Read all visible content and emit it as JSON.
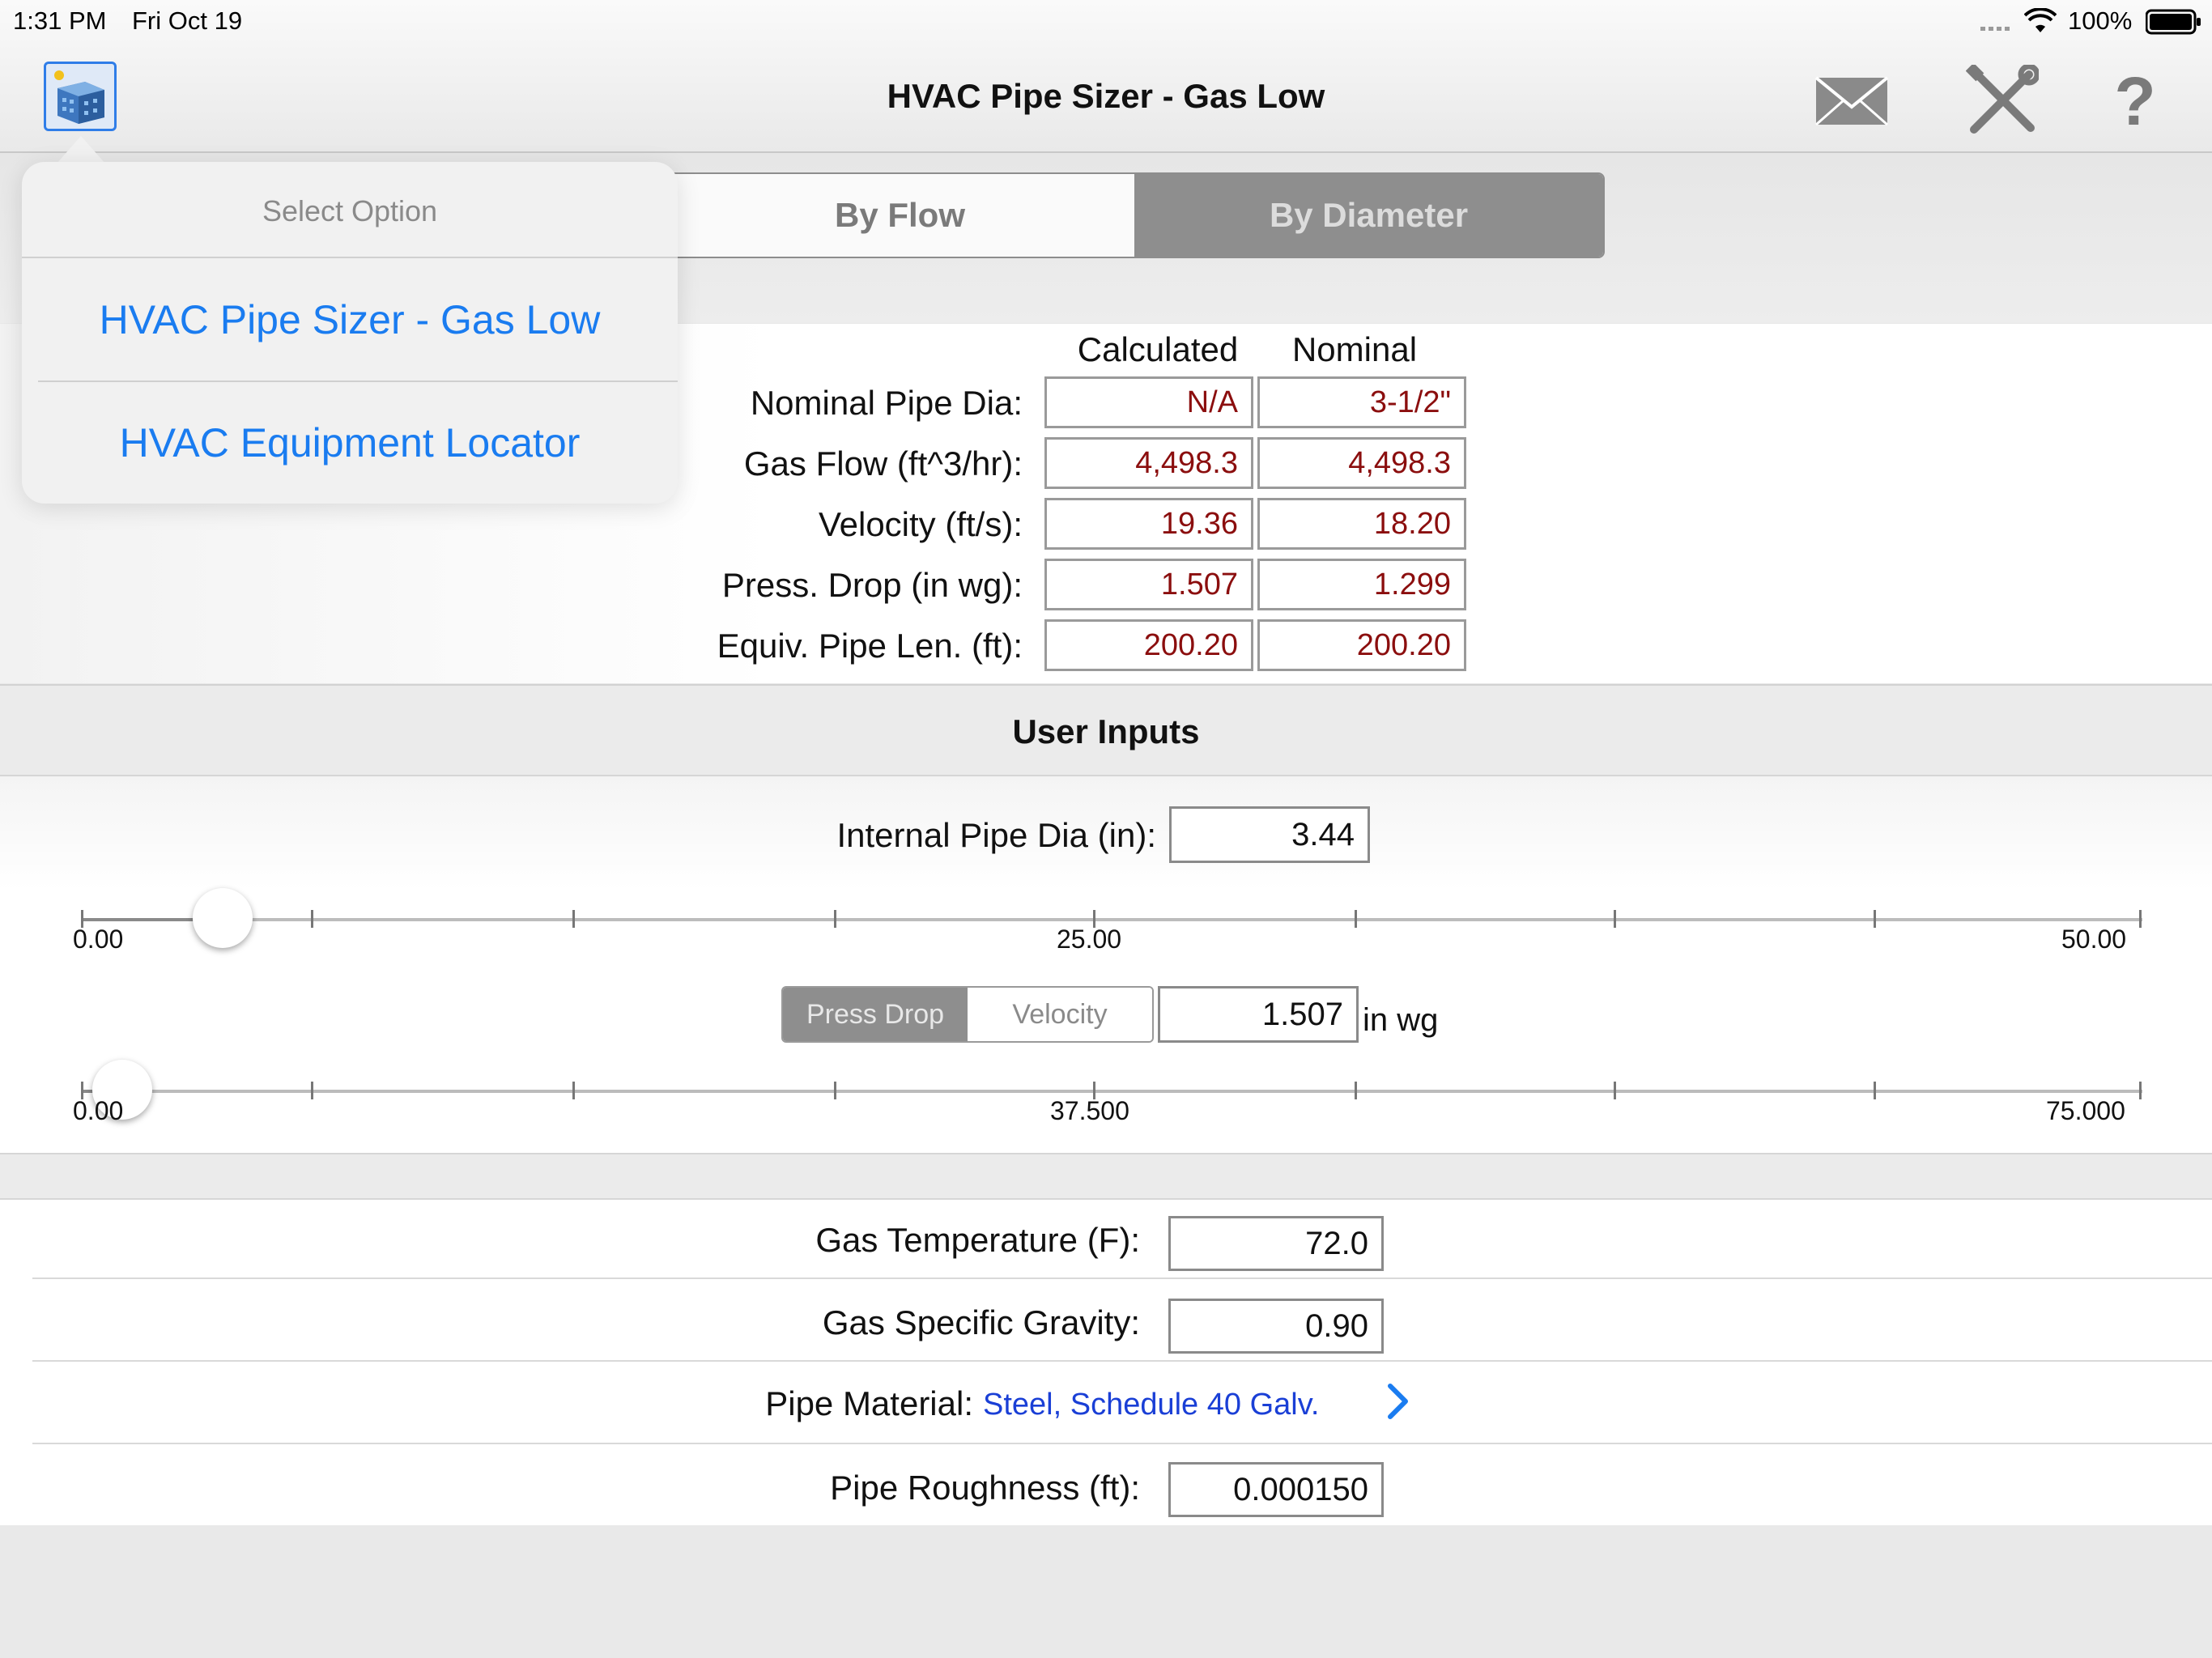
{
  "status_bar": {
    "time": "1:31 PM",
    "date": "Fri Oct 19",
    "battery": "100%"
  },
  "nav": {
    "title": "HVAC Pipe Sizer - Gas Low",
    "icons": [
      "app-icon",
      "mail-icon",
      "tools-icon",
      "help-icon"
    ]
  },
  "segment": {
    "by_flow": "By Flow",
    "by_diameter": "By Diameter",
    "selected": "By Diameter"
  },
  "popover": {
    "title": "Select Option",
    "items": [
      "HVAC Pipe Sizer - Gas Low",
      "HVAC Equipment Locator"
    ]
  },
  "results": {
    "col_calculated": "Calculated",
    "col_nominal": "Nominal",
    "rows": [
      {
        "label": "Nominal Pipe Dia:",
        "calculated": "N/A",
        "nominal": "3-1/2\""
      },
      {
        "label": "Gas Flow (ft^3/hr):",
        "calculated": "4,498.3",
        "nominal": "4,498.3"
      },
      {
        "label": "Velocity (ft/s):",
        "calculated": "19.36",
        "nominal": "18.20"
      },
      {
        "label": "Press. Drop (in wg):",
        "calculated": "1.507",
        "nominal": "1.299"
      },
      {
        "label": "Equiv. Pipe Len. (ft):",
        "calculated": "200.20",
        "nominal": "200.20"
      }
    ]
  },
  "user_inputs": {
    "header": "User Inputs",
    "internal_dia_label": "Internal Pipe Dia (in):",
    "internal_dia_value": "3.44",
    "slider1": {
      "min_label": "0.00",
      "mid_label": "25.00",
      "max_label": "50.00",
      "value": 3.44
    },
    "mode_press_drop": "Press Drop",
    "mode_velocity": "Velocity",
    "mode_selected": "Press Drop",
    "drop_value": "1.507",
    "drop_unit": "in wg",
    "slider2": {
      "min_label": "0.00",
      "mid_label": "37.500",
      "max_label": "75.000",
      "value": 1.507
    }
  },
  "params": {
    "gas_temp_label": "Gas Temperature (F):",
    "gas_temp_value": "72.0",
    "specific_gravity_label": "Gas Specific Gravity:",
    "specific_gravity_value": "0.90",
    "pipe_material_label": "Pipe Material:",
    "pipe_material_value": "Steel, Schedule 40 Galv.",
    "roughness_label": "Pipe Roughness (ft):",
    "roughness_value": "0.000150"
  },
  "colors": {
    "accent": "#1a7cf0",
    "result_text": "#8b0e0e",
    "link_blue": "#1a3fd6"
  }
}
